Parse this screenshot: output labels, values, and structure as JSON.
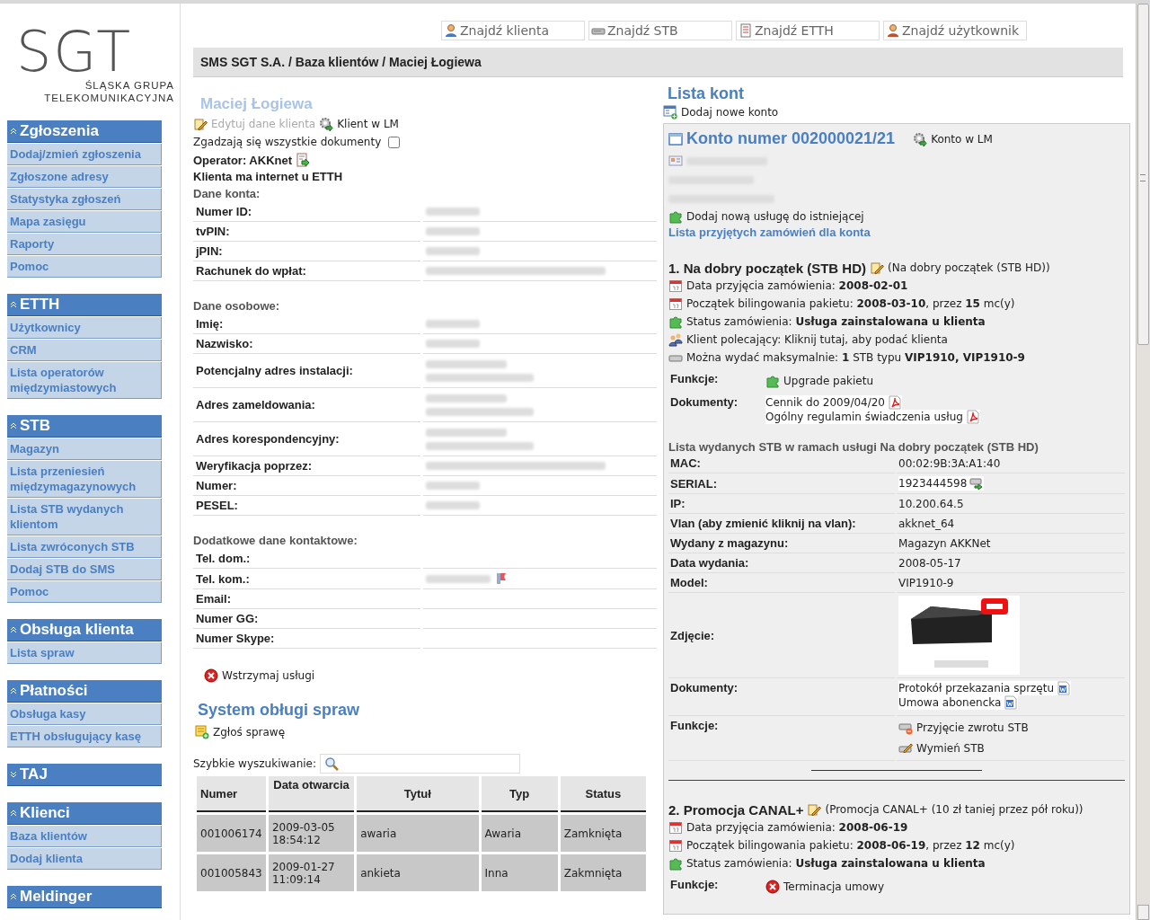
{
  "logo": {
    "mark": "SGT",
    "line1": "ŚLĄSKA GRUPA",
    "line2": "TELEKOMUNIKACYJNA"
  },
  "sidebar": [
    {
      "title": "Zgłoszenia",
      "expanded": true,
      "items": [
        "Dodaj/zmień zgłoszenia",
        "Zgłoszone adresy",
        "Statystyka zgłoszeń",
        "Mapa zasięgu",
        "Raporty",
        "Pomoc"
      ]
    },
    {
      "title": "ETTH",
      "expanded": true,
      "items": [
        "Użytkownicy",
        "CRM",
        "Lista operatorów międzymiastowych"
      ]
    },
    {
      "title": "STB",
      "expanded": true,
      "items": [
        "Magazyn",
        "Lista przeniesień międzymagazynowych",
        "Lista STB wydanych klientom",
        "Lista zwróconych STB",
        "Dodaj STB do SMS",
        "Pomoc"
      ]
    },
    {
      "title": "Obsługa klienta",
      "expanded": true,
      "items": [
        "Lista spraw"
      ]
    },
    {
      "title": "Płatności",
      "expanded": true,
      "items": [
        "Obsługa kasy",
        "ETTH obsługujący kasę"
      ]
    },
    {
      "title": "TAJ",
      "expanded": false
    },
    {
      "title": "Klienci",
      "expanded": true,
      "items": [
        "Baza klientów",
        "Dodaj klienta"
      ]
    },
    {
      "title": "Meldinger",
      "expanded": true
    }
  ],
  "top_search": [
    {
      "label": "Znajdź klienta",
      "kind": "client"
    },
    {
      "label": "Znajdź STB",
      "kind": "stb"
    },
    {
      "label": "Znajdź ETTH",
      "kind": "etth"
    },
    {
      "label": "Znajdź użytkownik",
      "kind": "user"
    }
  ],
  "breadcrumb": "SMS SGT S.A. / Baza klientów / Maciej Łogiewa",
  "client": {
    "name": "Maciej Łogiewa",
    "edit_link": "Edytuj dane klienta",
    "lm_link": "Klient w LM",
    "documents_ok": {
      "label": "Zgadzają się wszystkie dokumenty",
      "checked": false
    },
    "operator": "Operator: AKKnet",
    "internet": "Klienta ma internet u ETTH",
    "sections": [
      {
        "title": "Dane konta:",
        "rows": [
          {
            "label": "Numer ID:",
            "kind": "hidden"
          },
          {
            "label": "tvPIN:",
            "kind": "hidden"
          },
          {
            "label": "jPIN:",
            "kind": "hidden"
          },
          {
            "label": "Rachunek do wpłat:",
            "kind": "hidden-long"
          }
        ]
      },
      {
        "title": "Dane osobowe:",
        "rows": [
          {
            "label": "Imię:",
            "kind": "hidden"
          },
          {
            "label": "Nazwisko:",
            "kind": "hidden"
          },
          {
            "label": "Potencjalny adres instalacji:",
            "kind": "hidden-address"
          },
          {
            "label": "Adres zameldowania:",
            "kind": "hidden-address"
          },
          {
            "label": "Adres korespondencyjny:",
            "kind": "hidden-address"
          },
          {
            "label": "Weryfikacja poprzez:",
            "kind": "hidden-long"
          },
          {
            "label": "Numer:",
            "kind": "hidden"
          },
          {
            "label": "PESEL:",
            "kind": "hidden"
          }
        ]
      },
      {
        "title": "Dodatkowe dane kontaktowe:",
        "rows": [
          {
            "label": "Tel. dom.:",
            "kind": "empty"
          },
          {
            "label": "Tel. kom.:",
            "kind": "hidden-phone"
          },
          {
            "label": "Email:",
            "kind": "empty"
          },
          {
            "label": "Numer GG:",
            "kind": "empty"
          },
          {
            "label": "Numer Skype:",
            "kind": "empty"
          }
        ]
      }
    ],
    "suspend": "Wstrzymaj usługi"
  },
  "cases": {
    "title": "System obługi spraw",
    "report": "Zgłoś sprawę",
    "search_label": "Szybkie wyszukiwanie:",
    "columns": [
      "Numer",
      "Data otwarcia",
      "Tytuł",
      "Typ",
      "Status"
    ],
    "rows": [
      [
        "001006174",
        "2009-03-05 18:54:12",
        "awaria",
        "Awaria",
        "Zamknięta"
      ],
      [
        "001005843",
        "2009-01-27 11:09:14",
        "ankieta",
        "Inna",
        "Zakmnięta"
      ]
    ]
  },
  "accounts": {
    "title": "Lista kont",
    "add": "Dodaj nowe konto",
    "account": {
      "title": "Konto numer 002000021/21",
      "lm": "Konto w LM",
      "add_service": "Dodaj nową usługę do istniejącej",
      "orders_link": "Lista przyjętych zamówień dla konta",
      "services": [
        {
          "title": "1. Na dobry początek (STB HD)",
          "subtitle": "(Na dobry początek (STB HD))",
          "lines": [
            {
              "kind": "date",
              "text": "Data przyjęcia zamówienia: **2008-02-01**"
            },
            {
              "kind": "date",
              "text": "Początek bilingowania pakietu: **2008-03-10**, przez **15** mc(y)"
            },
            {
              "kind": "status",
              "text": "Status zamówienia: **Usługa zainstalowana u klienta**"
            },
            {
              "kind": "referrer",
              "text": "Klient polecający: Kliknij tutaj, aby podać klienta"
            },
            {
              "kind": "device",
              "text": "Można wydać maksymalnie: **1** STB typu **VIP1910, VIP1910-9**"
            }
          ],
          "functions_label": "Funkcje:",
          "functions": [
            {
              "kind": "upgrade",
              "label": "Upgrade pakietu"
            }
          ],
          "documents_label": "Dokumenty:",
          "documents": [
            {
              "kind": "pdf",
              "label": "Cennik do 2009/04/20"
            },
            {
              "kind": "pdf",
              "label": "Ogólny regulamin świadczenia usług"
            }
          ],
          "stb": {
            "title": "Lista wydanych STB w ramach usługi Na dobry początek (STB HD)",
            "rows": [
              {
                "label": "MAC:",
                "value": "00:02:9B:3A:A1:40",
                "kind": "text"
              },
              {
                "label": "SERIAL:",
                "value": "1923444598",
                "kind": "serial"
              },
              {
                "label": "IP:",
                "value": "10.200.64.5",
                "kind": "text"
              },
              {
                "label": "Vlan (aby zmienić kliknij na vlan):",
                "value": "akknet_64",
                "kind": "text"
              },
              {
                "label": "Wydany z magazynu:",
                "value": "Magazyn AKKNet",
                "kind": "text"
              },
              {
                "label": "Data wydania:",
                "value": "2008-05-17",
                "kind": "text"
              },
              {
                "label": "Model:",
                "value": "VIP1910-9",
                "kind": "text"
              },
              {
                "label": "Zdjęcie:",
                "kind": "photo"
              }
            ],
            "documents_label": "Dokumenty:",
            "documents": [
              {
                "kind": "word",
                "label": "Protokół przekazania sprzętu"
              },
              {
                "kind": "word",
                "label": "Umowa abonencka"
              }
            ],
            "functions_label": "Funkcje:",
            "functions": [
              {
                "kind": "return",
                "label": "Przyjęcie zwrotu STB"
              },
              {
                "kind": "swap",
                "label": "Wymień STB"
              }
            ]
          }
        },
        {
          "title": "2. Promocja CANAL+",
          "subtitle": "(Promocja CANAL+ (10 zł taniej przez pół roku))",
          "lines": [
            {
              "kind": "date",
              "text": "Data przyjęcia zamówienia: **2008-06-19**"
            },
            {
              "kind": "date",
              "text": "Początek bilingowania pakietu: **2008-06-19**, przez **12** mc(y)"
            },
            {
              "kind": "status",
              "text": "Status zamówienia: **Usługa zainstalowana u klienta**"
            }
          ],
          "functions_label": "Funkcje:",
          "functions": [
            {
              "kind": "terminate",
              "label": "Terminacja umowy"
            }
          ]
        }
      ]
    }
  }
}
